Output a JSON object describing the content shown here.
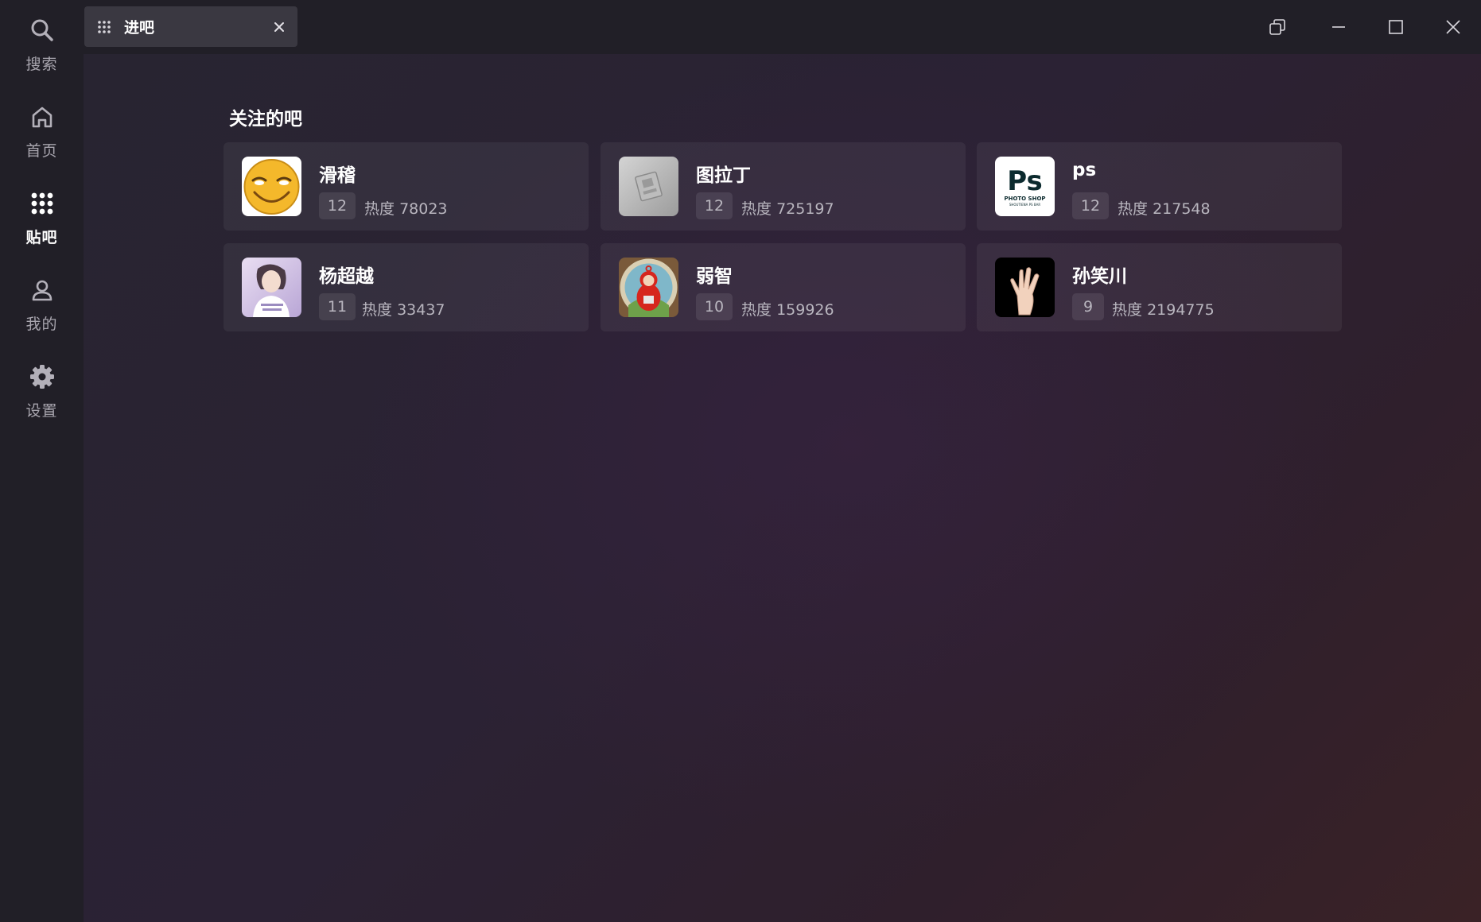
{
  "sidebar": {
    "items": [
      {
        "label": "搜索",
        "icon": "search-icon"
      },
      {
        "label": "首页",
        "icon": "home-icon"
      },
      {
        "label": "贴吧",
        "icon": "grid-icon",
        "active": true
      },
      {
        "label": "我的",
        "icon": "user-icon"
      },
      {
        "label": "设置",
        "icon": "gear-icon"
      }
    ]
  },
  "tab": {
    "label": "进吧",
    "icon": "grid-icon",
    "close_icon": "close-icon"
  },
  "window_controls": [
    "restore-icon",
    "minimize-icon",
    "maximize-icon",
    "close-icon"
  ],
  "main": {
    "section_title": "关注的吧",
    "heat_prefix": "热度",
    "forums": [
      {
        "name": "滑稽",
        "level": "12",
        "heat": "78023",
        "avatar": "funny-face-avatar"
      },
      {
        "name": "图拉丁",
        "level": "12",
        "heat": "725197",
        "avatar": "chip-avatar"
      },
      {
        "name": "ps",
        "level": "12",
        "heat": "217548",
        "avatar": "photoshop-logo-avatar",
        "avatar_text": [
          "Ps",
          "PHOTO SHOP",
          "SHOUTIENA PS BAR"
        ]
      },
      {
        "name": "杨超越",
        "level": "11",
        "heat": "33437",
        "avatar": "portrait-avatar"
      },
      {
        "name": "弱智",
        "level": "10",
        "heat": "159926",
        "avatar": "teletubby-avatar"
      },
      {
        "name": "孙笑川",
        "level": "9",
        "heat": "2194775",
        "avatar": "hand-gesture-avatar"
      }
    ]
  },
  "colors": {
    "sidebar_bg": "#211f27",
    "tab_bg": "#3a3841",
    "card_bg": "rgba(255,255,255,0.055)",
    "muted_text": "#b9b6bf",
    "active_text": "#ffffff"
  }
}
